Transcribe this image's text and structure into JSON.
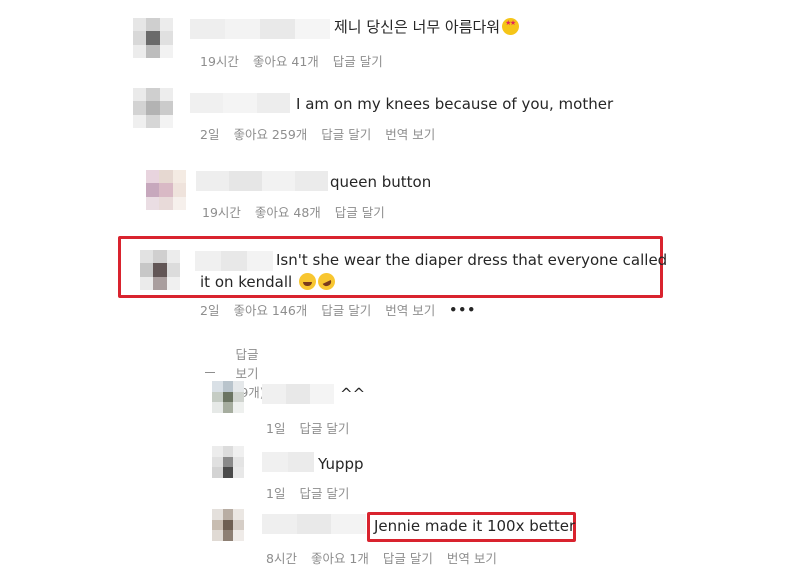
{
  "comments": [
    {
      "text": "제니 당신은 너무 아름다워",
      "emoji": "star-struck-emoji",
      "meta": {
        "time": "19시간",
        "likes": "좋아요 41개",
        "reply": "답글 달기"
      }
    },
    {
      "text": "I am on my knees because of you, mother",
      "meta": {
        "time": "2일",
        "likes": "좋아요 259개",
        "reply": "답글 달기",
        "translate": "번역 보기"
      }
    },
    {
      "text": "queen button",
      "meta": {
        "time": "19시간",
        "likes": "좋아요 48개",
        "reply": "답글 달기"
      }
    },
    {
      "text_line1": "Isn't she wear the diaper dress that everyone called",
      "text_line2": "it on kendall",
      "emojis": [
        "laughing-emoji",
        "rolling-laughing-emoji"
      ],
      "meta": {
        "time": "2일",
        "likes": "좋아요 146개",
        "reply": "답글 달기",
        "translate": "번역 보기",
        "more": "•••"
      },
      "view_replies": "답글 보기(9개)"
    }
  ],
  "replies": [
    {
      "text": "^^",
      "meta": {
        "time": "1일",
        "reply": "답글 달기"
      }
    },
    {
      "text": "Yuppp",
      "meta": {
        "time": "1일",
        "reply": "답글 달기"
      }
    },
    {
      "text": "Jennie made it 100x better",
      "meta": {
        "time": "8시간",
        "likes": "좋아요 1개",
        "reply": "답글 달기",
        "translate": "번역 보기"
      }
    }
  ],
  "colors": {
    "highlight": "#d9232e",
    "muted": "#8e8e8e",
    "text": "#262626"
  }
}
